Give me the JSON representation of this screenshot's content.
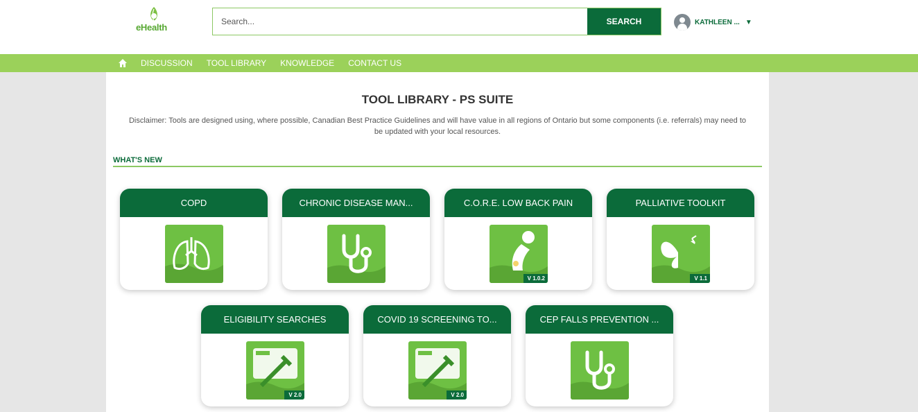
{
  "header": {
    "logo_text": "eHealth",
    "search": {
      "placeholder": "Search..."
    },
    "search_button": "SEARCH",
    "user_name": "KATHLEEN ..."
  },
  "nav": {
    "items": [
      "DISCUSSION",
      "TOOL LIBRARY",
      "KNOWLEDGE",
      "CONTACT US"
    ]
  },
  "page": {
    "title": "TOOL LIBRARY - PS SUITE",
    "disclaimer": "Disclaimer: Tools are designed using, where possible, Canadian Best Practice Guidelines and will have value in all regions of Ontario but some components (i.e. referrals) may need to be updated with your local resources.",
    "section_heading": "WHAT'S NEW"
  },
  "cards": [
    {
      "title": "COPD",
      "icon": "lungs-icon",
      "version": ""
    },
    {
      "title": "CHRONIC DISEASE MAN...",
      "icon": "stethoscope-icon",
      "version": ""
    },
    {
      "title": "C.O.R.E. LOW BACK PAIN",
      "icon": "back-pain-icon",
      "version": "V 1.0.2"
    },
    {
      "title": "PALLIATIVE TOOLKIT",
      "icon": "butterfly-icon",
      "version": "V 1.1"
    },
    {
      "title": "ELIGIBILITY SEARCHES",
      "icon": "syringe-icon",
      "version": "V 2.0"
    },
    {
      "title": "COVID 19 SCREENING TO...",
      "icon": "syringe-icon",
      "version": "V 2.0"
    },
    {
      "title": "CEP FALLS PREVENTION ...",
      "icon": "stethoscope-icon",
      "version": ""
    }
  ],
  "colors": {
    "dark_green": "#0b6b3a",
    "nav_green": "#9bd15a",
    "icon_green": "#6ec043",
    "background": "#e6e6e6"
  }
}
